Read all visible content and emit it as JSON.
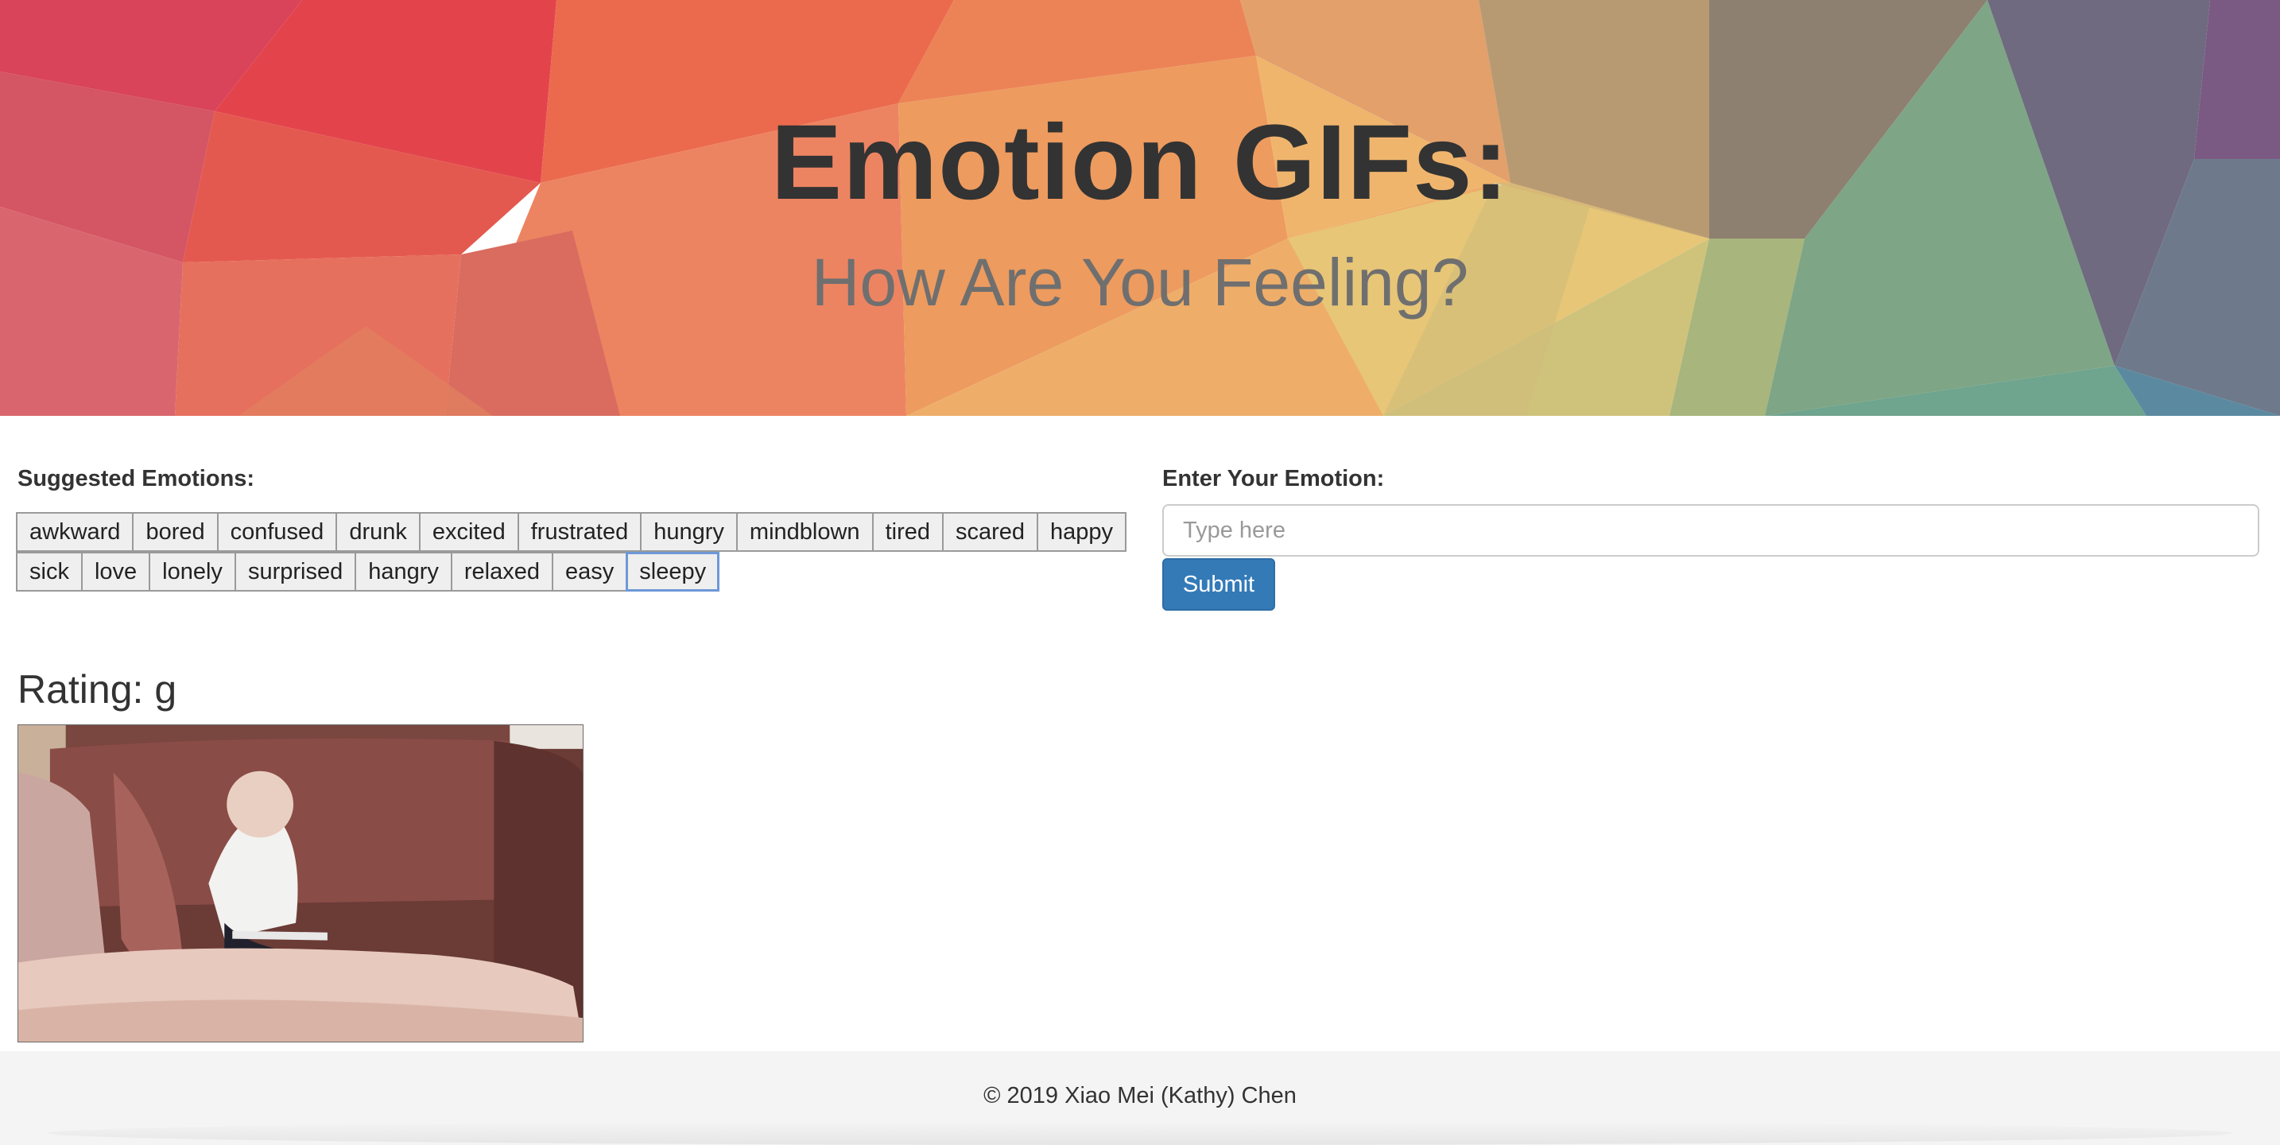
{
  "hero": {
    "title": "Emotion GIFs:",
    "subtitle": "How Are You Feeling?"
  },
  "suggested": {
    "label": "Suggested Emotions:",
    "buttons": [
      "awkward",
      "bored",
      "confused",
      "drunk",
      "excited",
      "frustrated",
      "hungry",
      "mindblown",
      "tired",
      "scared",
      "happy",
      "sick",
      "love",
      "lonely",
      "surprised",
      "hangry",
      "relaxed",
      "easy",
      "sleepy"
    ],
    "focused": "sleepy"
  },
  "entry": {
    "label": "Enter Your Emotion:",
    "placeholder": "Type here",
    "value": "",
    "submit_label": "Submit"
  },
  "result": {
    "rating": "Rating: g"
  },
  "footer": {
    "copyright": "© 2019 Xiao Mei (Kathy) Chen"
  },
  "colors": {
    "submit": "#337ab7",
    "focus_ring": "#6e98d8",
    "title": "#333333",
    "subtitle": "#6f6f6f"
  }
}
